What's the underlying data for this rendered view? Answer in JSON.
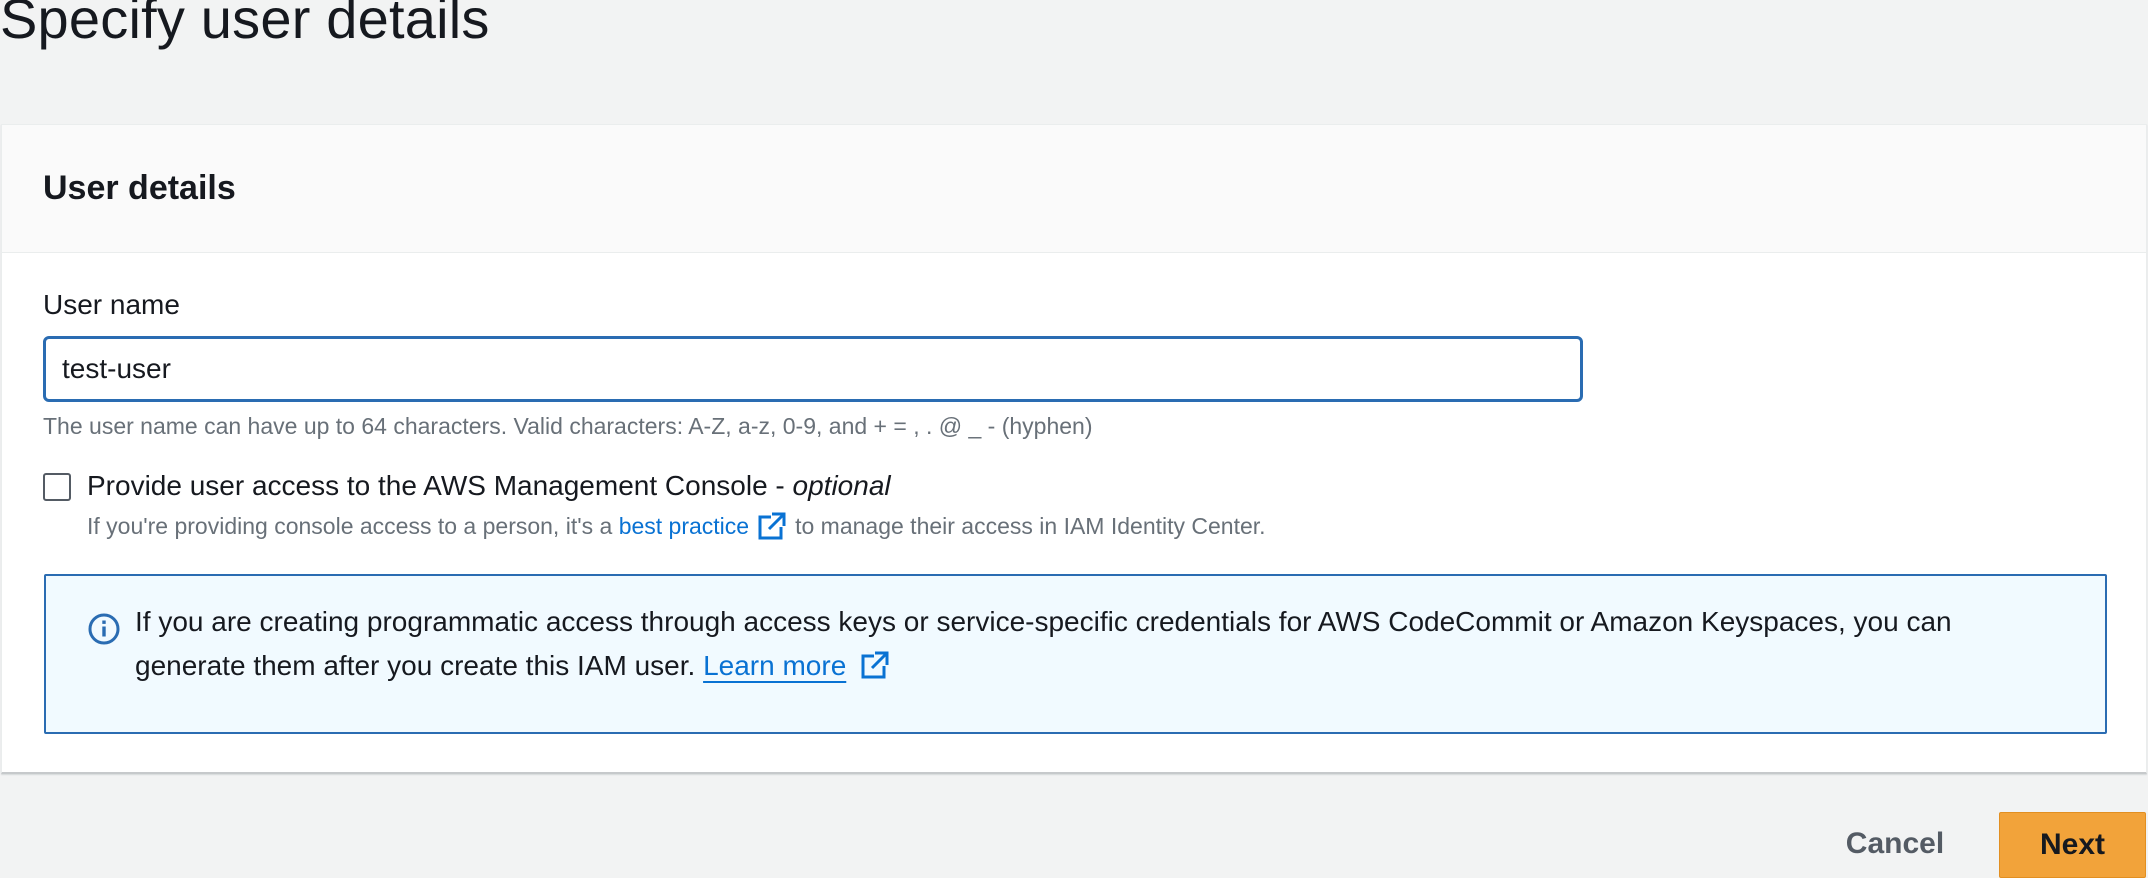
{
  "page": {
    "title": "Specify user details"
  },
  "panel": {
    "header": "User details",
    "username": {
      "label": "User name",
      "value": "test-user",
      "hint": "The user name can have up to 64 characters. Valid characters: A-Z, a-z, 0-9, and + = , . @ _ - (hyphen)"
    },
    "console_access": {
      "label": "Provide user access to the AWS Management Console - ",
      "optional": "optional",
      "checked": false,
      "desc_before": "If you're providing console access to a person, it's a",
      "desc_link": "best practice",
      "desc_after": "to manage their access in IAM Identity Center."
    },
    "info": {
      "text": "If you are creating programmatic access through access keys or service-specific credentials for AWS CodeCommit or Amazon Keyspaces, you can generate them after you create this IAM user.",
      "link": "Learn more",
      "icon": "info-icon"
    }
  },
  "footer": {
    "cancel_label": "Cancel",
    "next_label": "Next"
  },
  "colors": {
    "accent": "#2a6cb2",
    "link": "#0972d3",
    "primary_button": "#f2a33a",
    "info_background": "#f1faff"
  }
}
